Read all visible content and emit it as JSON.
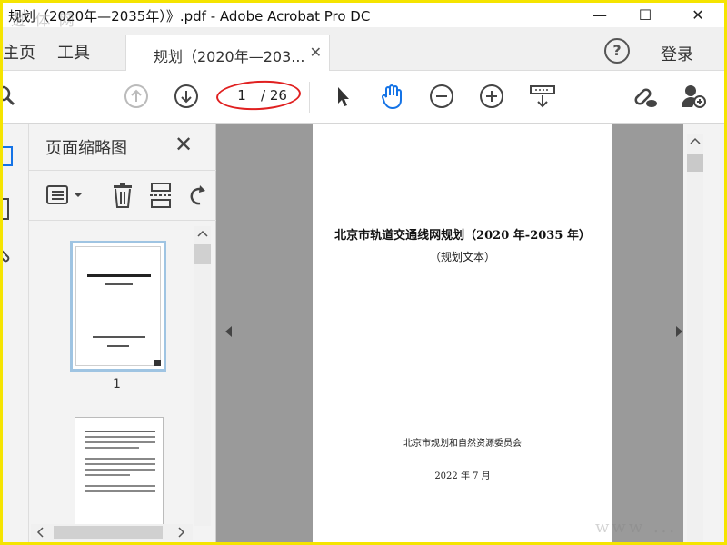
{
  "window": {
    "title": "规划（2020年—2035年）》.pdf - Adobe Acrobat Pro DC",
    "minimize_glyph": "—",
    "maximize_glyph": "☐",
    "close_glyph": "✕"
  },
  "watermarks": {
    "top": "逊 体 网",
    "bottom": "www ... com"
  },
  "tabs": {
    "home_label": "主页",
    "tools_label": "工具",
    "document_label": "规划（2020年—203...",
    "document_close": "✕",
    "help_glyph": "?",
    "login_label": "登录"
  },
  "toolbar": {
    "current_page": "1",
    "total_pages": "/ 26",
    "highlight_color": "#e02020",
    "accent_color": "#1473e6"
  },
  "thumbnails_panel": {
    "title": "页面缩略图",
    "close_glyph": "✕",
    "pages": [
      {
        "label": "1",
        "selected": true
      },
      {
        "label": "",
        "selected": false
      }
    ]
  },
  "document": {
    "title": "北京市轨道交通线网规划（2020 年-2035 年）",
    "subtitle": "（规划文本）",
    "organization": "北京市规划和自然资源委员会",
    "date": "2022 年 7 月"
  }
}
